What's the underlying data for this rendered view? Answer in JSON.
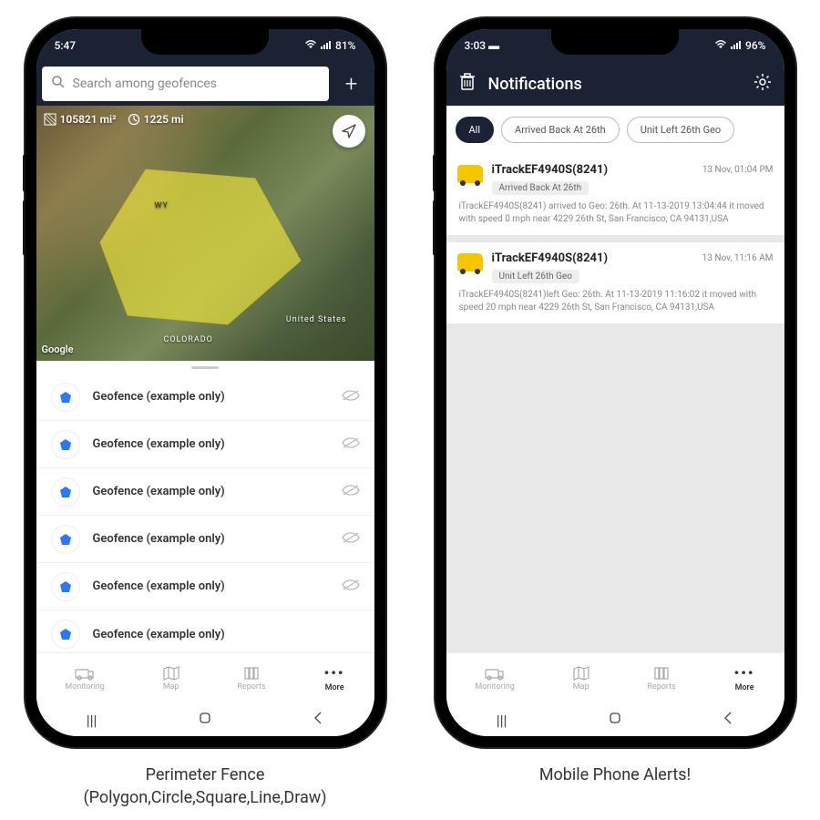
{
  "left": {
    "status_time": "5:47",
    "status_battery": "81%",
    "search_placeholder": "Search among geofences",
    "map_area": "105821 mi²",
    "map_perimeter": "1225 mi",
    "map_label_us": "United States",
    "map_label_co": "COLORADO",
    "map_label_wy": "WY",
    "map_attrib": "Google",
    "geofence_items": [
      "Geofence (example only)",
      "Geofence (example only)",
      "Geofence (example only)",
      "Geofence (example only)",
      "Geofence (example only)",
      "Geofence (example only)"
    ],
    "tabs": {
      "monitoring": "Monitoring",
      "map": "Map",
      "reports": "Reports",
      "more": "More"
    },
    "caption_line1": "Perimeter Fence",
    "caption_line2": "(Polygon,Circle,Square,Line,Draw)"
  },
  "right": {
    "status_time": "3:03",
    "status_battery": "96%",
    "title": "Notifications",
    "filters": {
      "all": "All",
      "f1": "Arrived Back At 26th",
      "f2": "Unit Left 26th Geo"
    },
    "items": [
      {
        "name": "iTrackEF4940S(8241)",
        "time": "13 Nov, 01:04 PM",
        "tag": "Arrived Back At 26th",
        "body": "iTrackEF4940S(8241) arrived to Geo: 26th.     At 11-13-2019 13:04:44 it moved with speed 0 mph near 4229 26th St, San Francisco, CA 94131,USA"
      },
      {
        "name": "iTrackEF4940S(8241)",
        "time": "13 Nov, 11:16 AM",
        "tag": "Unit Left 26th Geo",
        "body": "iTrackEF4940S(8241)left Geo: 26th.     At 11-13-2019 11:16:02 it moved with speed 20 mph near 4229 26th St, San Francisco, CA 94131,USA"
      }
    ],
    "tabs": {
      "monitoring": "Monitoring",
      "map": "Map",
      "reports": "Reports",
      "more": "More"
    },
    "caption": "Mobile Phone Alerts!"
  }
}
